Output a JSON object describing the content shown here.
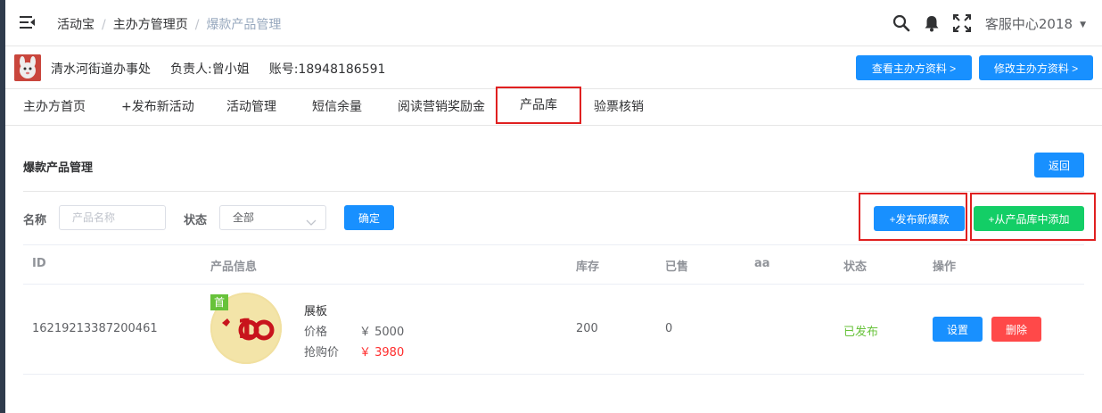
{
  "breadcrumb": [
    "活动宝",
    "主办方管理页",
    "爆款产品管理"
  ],
  "user_menu": "客服中心2018",
  "organizer": {
    "name": "清水河街道办事处",
    "contact": "负责人:曾小姐",
    "account": "账号:18948186591",
    "view_button": "查看主办方资料 >",
    "edit_button": "修改主办方资料 >"
  },
  "tabs": [
    "主办方首页",
    "+发布新活动",
    "活动管理",
    "短信余量",
    "阅读营销奖励金",
    "产品库",
    "验票核销"
  ],
  "section": {
    "title": "爆款产品管理",
    "back_button": "返回"
  },
  "filter": {
    "name_label": "名称",
    "name_placeholder": "产品名称",
    "status_label": "状态",
    "status_value": "全部",
    "confirm_button": "确定",
    "publish_button": "+发布新爆款",
    "add_from_library_button": "+从产品库中添加"
  },
  "table": {
    "columns": [
      "ID",
      "产品信息",
      "库存",
      "已售",
      "aa",
      "状态",
      "操作"
    ],
    "rows": [
      {
        "id": "16219213387200461",
        "badge": "首",
        "name": "展板",
        "price_label": "价格",
        "price": "￥ 5000",
        "rush_label": "抢购价",
        "rush_price": "￥ 3980",
        "stock": "200",
        "sold": "0",
        "aa": "",
        "status": "已发布",
        "set_button": "设置",
        "delete_button": "删除"
      }
    ]
  },
  "colors": {
    "primary": "#1890ff",
    "success": "#13ce66",
    "danger": "#ff4949",
    "highlight": "#e02020",
    "published": "#67c23a",
    "rush_price": "#ff2c2c"
  },
  "icons": [
    "menu-toggle-icon",
    "search-icon",
    "bell-icon",
    "fullscreen-icon",
    "caret-down-icon",
    "chevron-down-icon"
  ]
}
